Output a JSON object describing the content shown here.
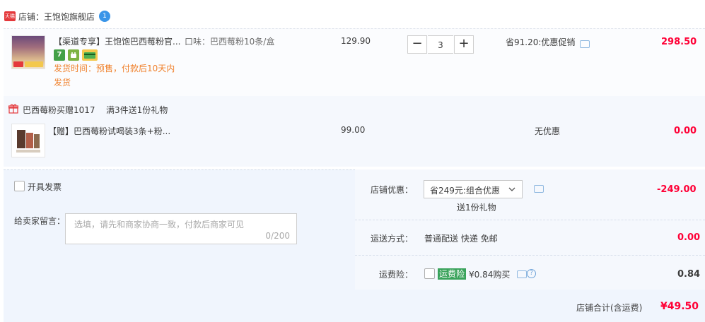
{
  "shop": {
    "label": "店铺：王饱饱旗舰店",
    "badge_text": "天猫",
    "notice_count": "1"
  },
  "items": [
    {
      "title": "【渠道专享】王饱饱巴西莓粉官...",
      "sku": "口味：巴西莓粉10条/盒",
      "price": "129.90",
      "quantity": "3",
      "discount": "省91.20:优惠促销",
      "ship_line1": "发货时间：预售，付款后10天内",
      "ship_line2": "发货",
      "subtotal": "298.50"
    },
    {
      "title": "【赠】巴西莓粉试喝装3条+粉...",
      "price": "99.00",
      "discount": "无优惠",
      "subtotal": "0.00"
    }
  ],
  "gift": {
    "name": "巴西莓粉买赠1017",
    "rule": "满3件送1份礼物"
  },
  "invoice_label": "开具发票",
  "message": {
    "label": "给卖家留言：",
    "placeholder": "选填，请先和商家协商一致，付款后商家可见",
    "counter": "0/200"
  },
  "shop_discount": {
    "label": "店铺优惠：",
    "selected": "省249元:组合优惠",
    "note": "送1份礼物",
    "amount": "-249.00"
  },
  "shipping": {
    "label": "运送方式：",
    "value": "普通配送 快递 免邮",
    "amount": "0.00"
  },
  "insurance": {
    "label": "运费险：",
    "badge": "运费险",
    "price_text": "¥0.84购买",
    "amount": "0.84"
  },
  "total": {
    "label": "店铺合计(含运费)",
    "amount": "¥49.50"
  },
  "colors": {
    "price_red": "#ff0036",
    "ship_orange": "#f0812c",
    "insurance_green": "#3aa35b"
  }
}
